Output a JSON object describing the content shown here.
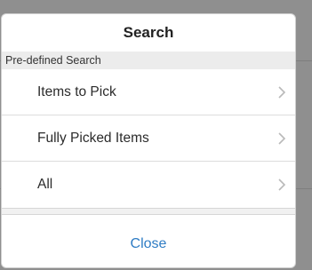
{
  "dialog": {
    "title": "Search",
    "section_label": "Pre-defined Search",
    "items": [
      {
        "label": "Items to Pick",
        "icon": "chevron-right-icon"
      },
      {
        "label": "Fully Picked Items",
        "icon": "chevron-right-icon"
      },
      {
        "label": "All",
        "icon": "chevron-right-icon"
      }
    ],
    "close_label": "Close"
  },
  "colors": {
    "accent": "#2e7cc4",
    "overlay": "#8f8f8f",
    "section_bg": "#ececec"
  }
}
